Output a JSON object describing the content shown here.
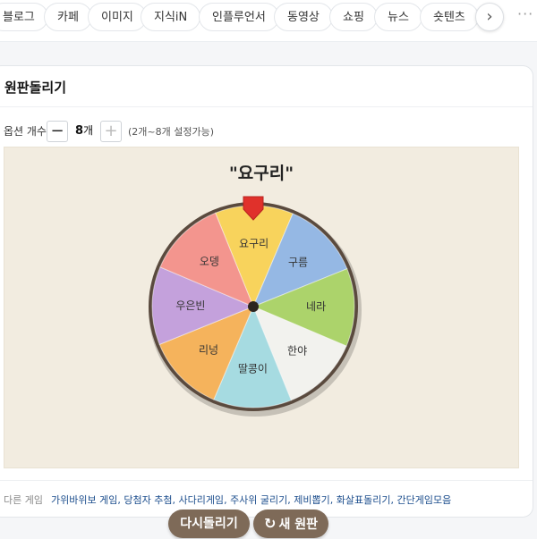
{
  "tabs": [
    "블로그",
    "카페",
    "이미지",
    "지식iN",
    "인플루언서",
    "동영상",
    "쇼핑",
    "뉴스",
    "숏텐츠"
  ],
  "tab_next_icon": "chevron-right-icon",
  "tab_more": "···",
  "card": {
    "title": "원판돌리기",
    "option_label": "옵션 개수",
    "minus": "−",
    "plus": "+",
    "option_count": "8",
    "option_unit": "개",
    "option_range": "(2개~8개 설정가능)"
  },
  "wheel": {
    "result": "\"요구리\"",
    "segments": [
      {
        "label": "요구리",
        "color": "#f8d35c"
      },
      {
        "label": "구름",
        "color": "#95b8e4"
      },
      {
        "label": "네라",
        "color": "#acd36b"
      },
      {
        "label": "한야",
        "color": "#f2f2ee"
      },
      {
        "label": "딸콩이",
        "color": "#a6dbe1"
      },
      {
        "label": "리넝",
        "color": "#f5b35c"
      },
      {
        "label": "우은빈",
        "color": "#c4a1dc"
      },
      {
        "label": "오뎅",
        "color": "#f3958e"
      }
    ],
    "pointer_color": "#e0312b",
    "rim_color": "#5a4a3e"
  },
  "buttons": {
    "respin": "다시돌리기",
    "new_wheel": "새 원판",
    "refresh_icon": "↻"
  },
  "other": {
    "label": "다른 게임",
    "links": [
      "가위바위보 게임",
      "당첨자 추첨",
      "사다리게임",
      "주사위 굴리기",
      "제비뽑기",
      "화살표돌리기",
      "간단게임모음"
    ]
  }
}
